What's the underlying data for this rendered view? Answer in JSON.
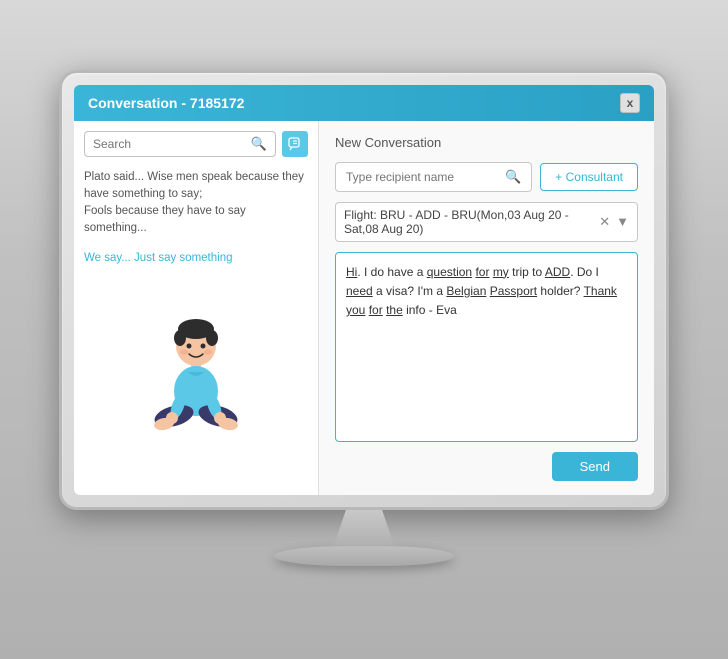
{
  "window": {
    "title": "Conversation - 7185172",
    "close_label": "x"
  },
  "left_panel": {
    "search_placeholder": "Search",
    "quote_line1": "Plato said... Wise men speak because they",
    "quote_line2": "have something to say;",
    "quote_line3": "Fools because they have to say",
    "quote_line4": "something...",
    "tagline": "We say... Just say something"
  },
  "right_panel": {
    "title": "New Conversation",
    "recipient_placeholder": "Type recipient name",
    "consultant_button": "+ Consultant",
    "flight_tag": "Flight: BRU - ADD - BRU(Mon,03 Aug 20 - Sat,08 Aug 20)",
    "message_text": "Hi, I do have a question for my trip to ADD. Do I need a visa? I'm a Belgian Passport holder? Thank you for the info - Eva",
    "send_button": "Send"
  }
}
